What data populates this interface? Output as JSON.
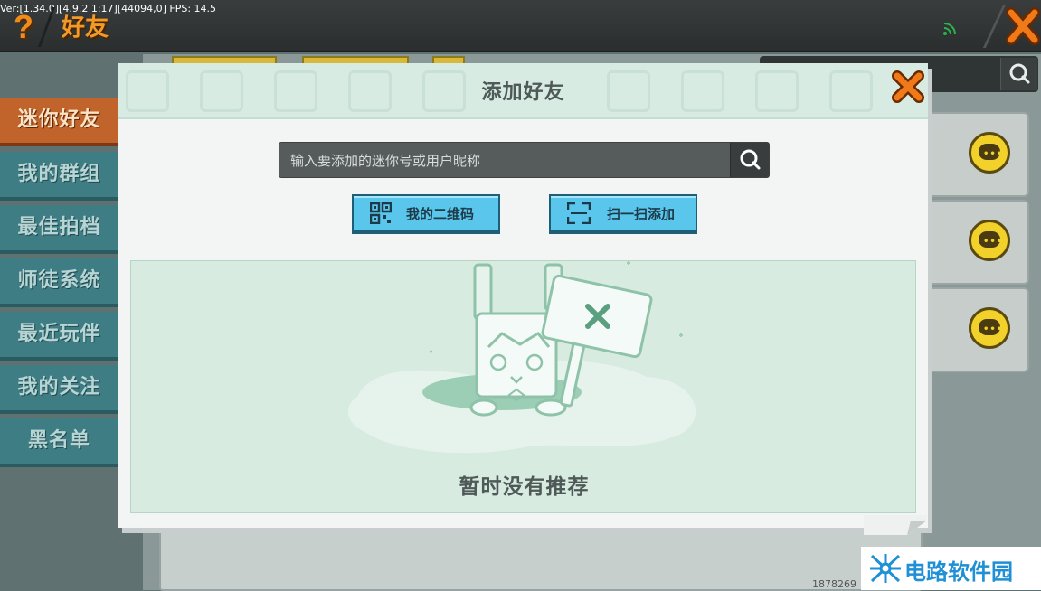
{
  "debug": {
    "text": "Ver:[1.34.0][4.9.2 1:17][44094,0] FPS: 14.5"
  },
  "header": {
    "title": "好友",
    "help_glyph": "?"
  },
  "sidebar": {
    "items": [
      {
        "label": "迷你好友",
        "active": true
      },
      {
        "label": "我的群组",
        "active": false
      },
      {
        "label": "最佳拍档",
        "active": false
      },
      {
        "label": "师徒系统",
        "active": false
      },
      {
        "label": "最近玩伴",
        "active": false
      },
      {
        "label": "我的关注",
        "active": false
      },
      {
        "label": "黑名单",
        "active": false
      }
    ]
  },
  "background": {
    "id_text": "1878269"
  },
  "modal": {
    "title": "添加好友",
    "search": {
      "placeholder": "输入要添加的迷你号或用户昵称",
      "value": ""
    },
    "buttons": {
      "my_qr": "我的二维码",
      "scan_add": "扫一扫添加"
    },
    "empty_text": "暂时没有推荐"
  },
  "watermark": {
    "text": "电路软件园"
  },
  "colors": {
    "accent_orange": "#f39a26",
    "button_blue": "#5ac6ec",
    "active_tab": "#c0642b",
    "tab": "#3f7d84",
    "chat_yellow": "#f2d12a",
    "signal_green": "#2bb24c"
  }
}
